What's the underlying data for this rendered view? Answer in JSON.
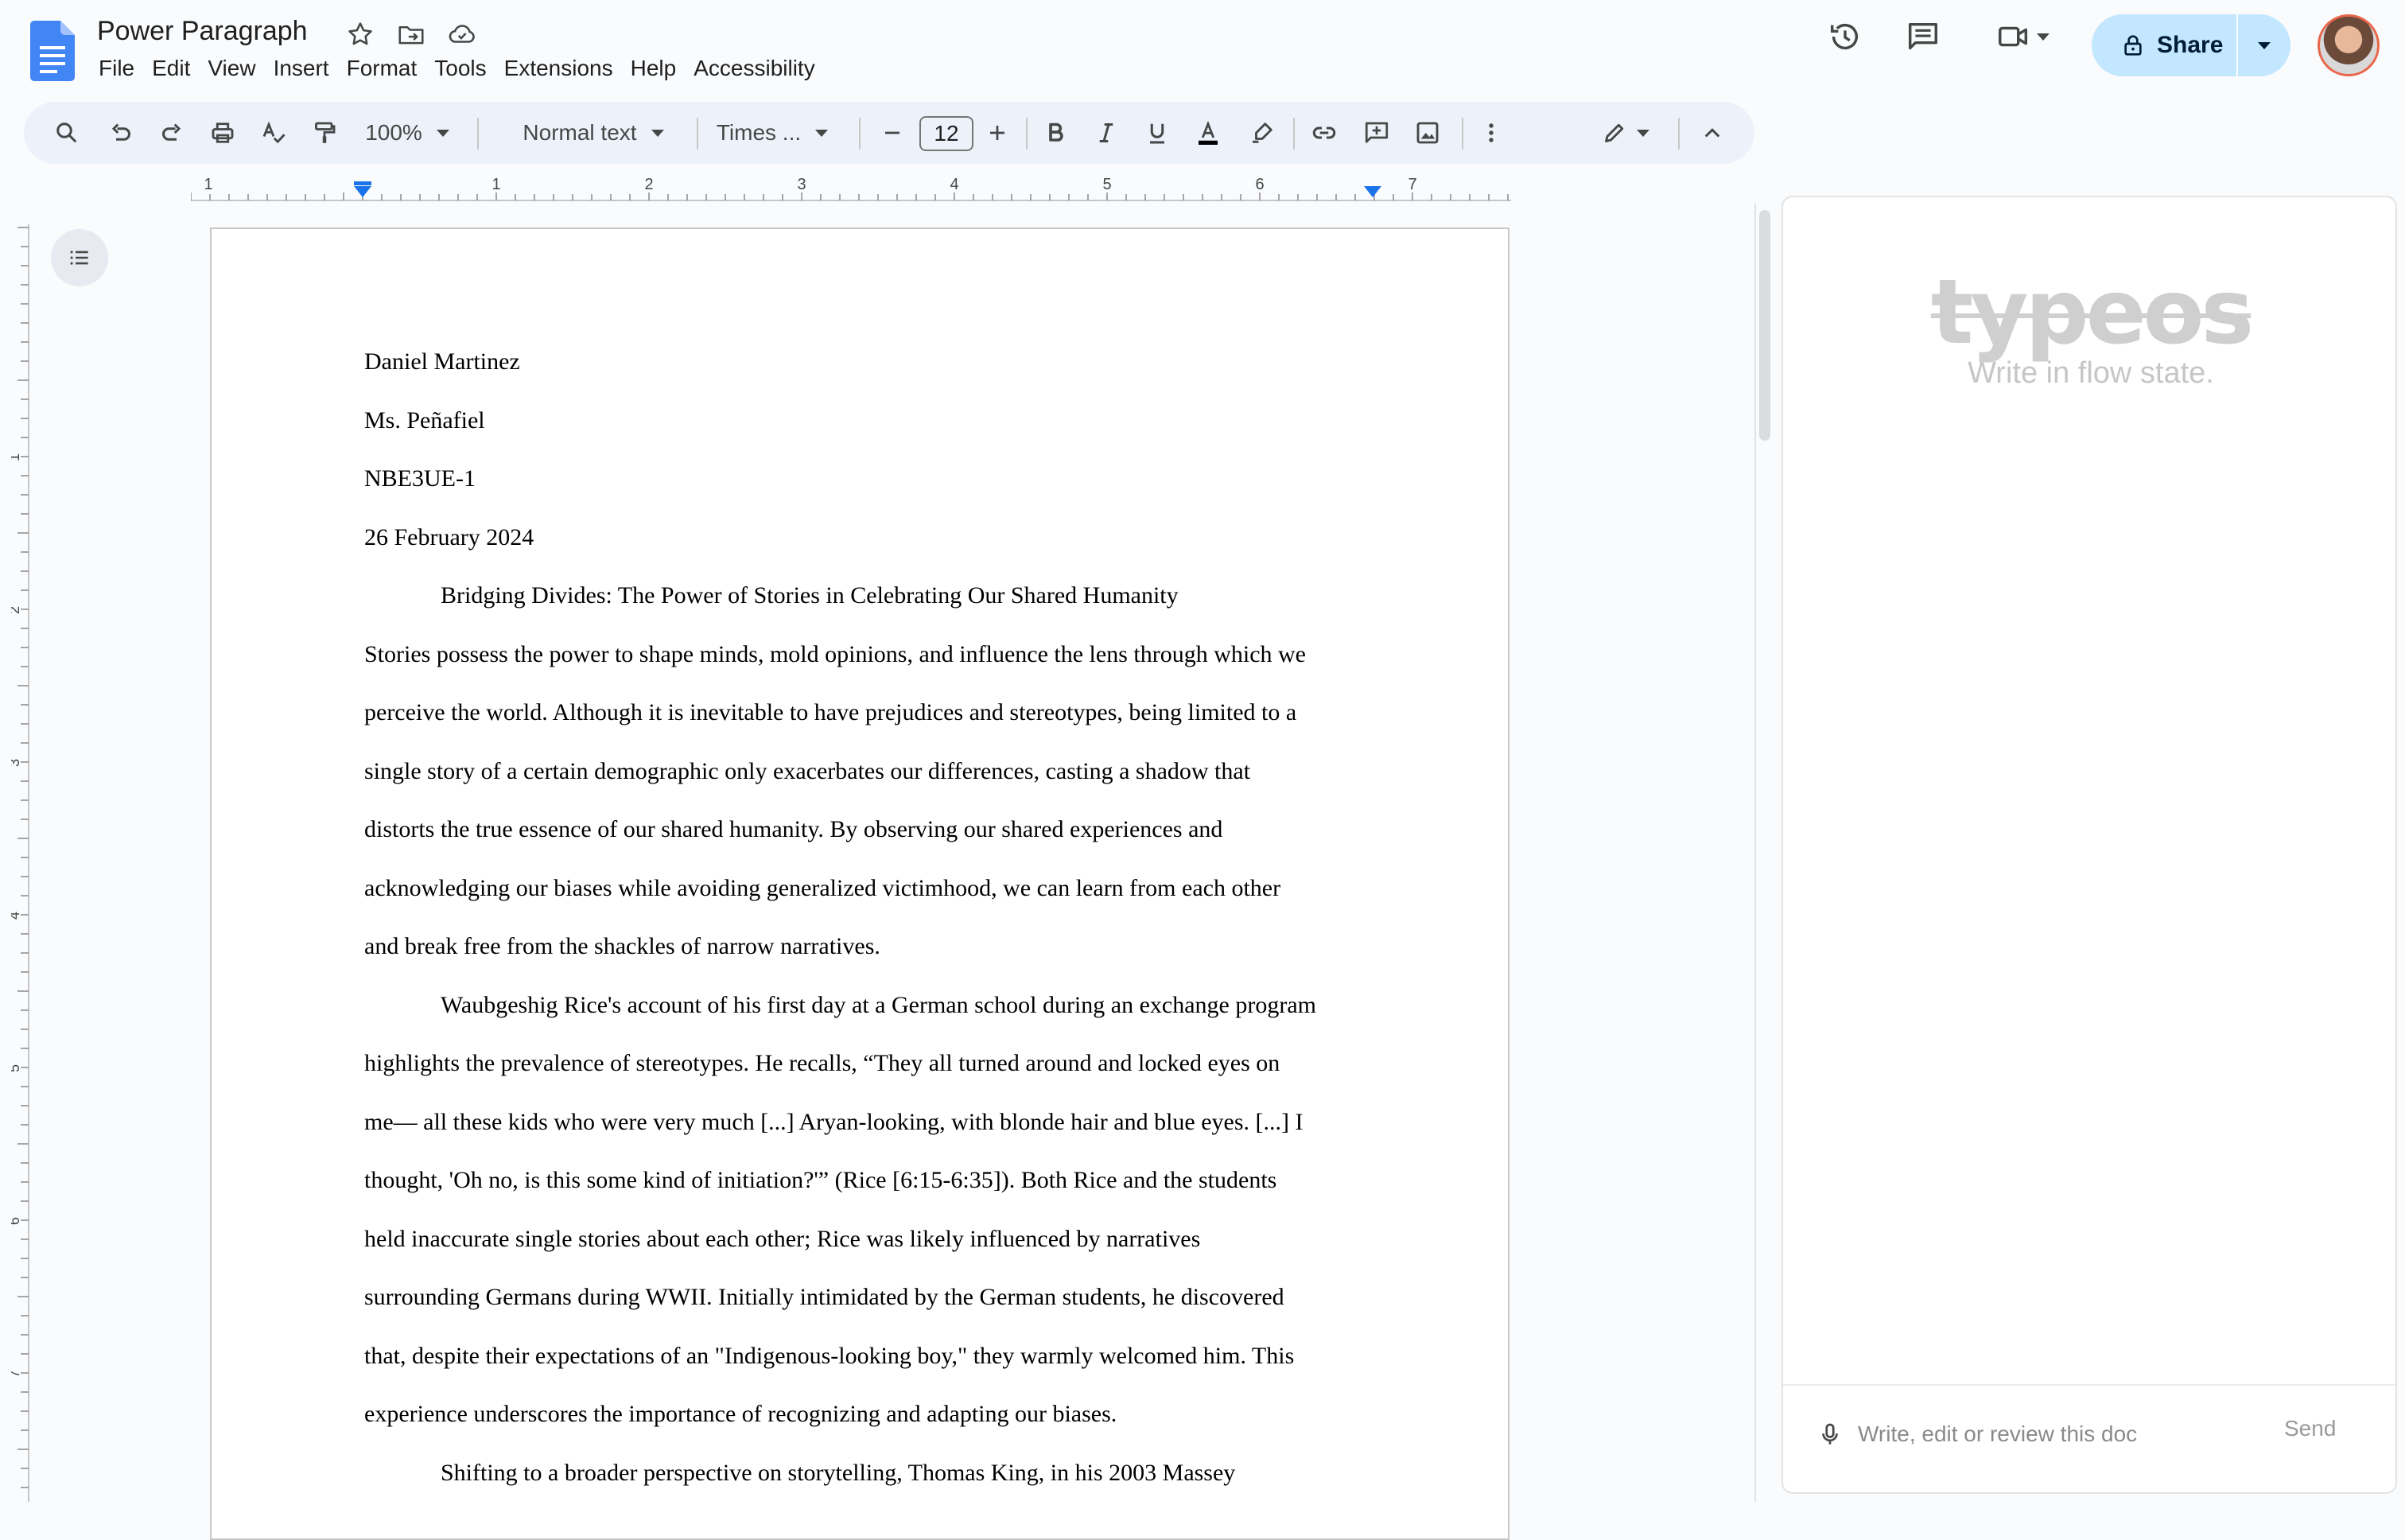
{
  "app": {
    "title": "Power Paragraph"
  },
  "menu": [
    "File",
    "Edit",
    "View",
    "Insert",
    "Format",
    "Tools",
    "Extensions",
    "Help",
    "Accessibility"
  ],
  "share": {
    "label": "Share"
  },
  "toolbar": {
    "zoom": "100%",
    "style": "Normal text",
    "font": "Times ...",
    "font_size": "12"
  },
  "ruler": {
    "h_labels": [
      "1",
      "1",
      "2",
      "3",
      "4",
      "5",
      "6",
      "7"
    ],
    "v_labels": [
      "1",
      "2",
      "3",
      "4",
      "5",
      "6",
      "7"
    ]
  },
  "document": {
    "lines": [
      {
        "text": "Daniel Martinez",
        "indent": false
      },
      {
        "text": "Ms. Peñafiel",
        "indent": false
      },
      {
        "text": "NBE3UE-1",
        "indent": false
      },
      {
        "text": "26 February 2024",
        "indent": false
      },
      {
        "text": "Bridging Divides: The Power of Stories in Celebrating Our Shared Humanity",
        "indent": true
      },
      {
        "text": "Stories possess the power to shape minds, mold opinions, and influence the lens through which we",
        "indent": false
      },
      {
        "text": "perceive the world. Although it is inevitable to have prejudices and stereotypes, being limited to a",
        "indent": false
      },
      {
        "text": "single story of a certain demographic only exacerbates our differences, casting a shadow that",
        "indent": false
      },
      {
        "text": "distorts the true essence of our shared humanity. By observing our shared experiences and",
        "indent": false
      },
      {
        "text": "acknowledging our biases while avoiding generalized victimhood, we can learn from each other",
        "indent": false
      },
      {
        "text": "and break free from the shackles of narrow narratives.",
        "indent": false
      },
      {
        "text": "Waubgeshig Rice's account of his first day at a German school during an exchange program",
        "indent": true
      },
      {
        "text": "highlights the prevalence of stereotypes. He recalls, “They all turned around and locked eyes on",
        "indent": false
      },
      {
        "text": "me— all these kids who were very much [...] Aryan-looking, with blonde hair and blue eyes. [...] I",
        "indent": false
      },
      {
        "text": "thought, 'Oh no, is this some kind of initiation?'” (Rice [6:15-6:35]). Both Rice and the students",
        "indent": false
      },
      {
        "text": "held inaccurate single stories about each other; Rice was likely influenced by narratives",
        "indent": false
      },
      {
        "text": "surrounding Germans during WWII. Initially intimidated by the German students, he discovered",
        "indent": false
      },
      {
        "text": "that, despite their expectations of an \"Indigenous-looking boy,\" they warmly welcomed him. This",
        "indent": false
      },
      {
        "text": "experience underscores the importance of recognizing and adapting our biases.",
        "indent": false
      },
      {
        "text": "Shifting to a broader perspective on storytelling, Thomas King, in his 2003 Massey",
        "indent": true
      }
    ]
  },
  "panel": {
    "brand": "typeos",
    "tagline": "Write in flow state.",
    "input_placeholder": "Write, edit or review this doc",
    "send_label": "Send"
  },
  "colors": {
    "accent": "#c2e7ff",
    "docs_blue": "#4285f4",
    "toolbar_bg": "#edf2fa"
  }
}
